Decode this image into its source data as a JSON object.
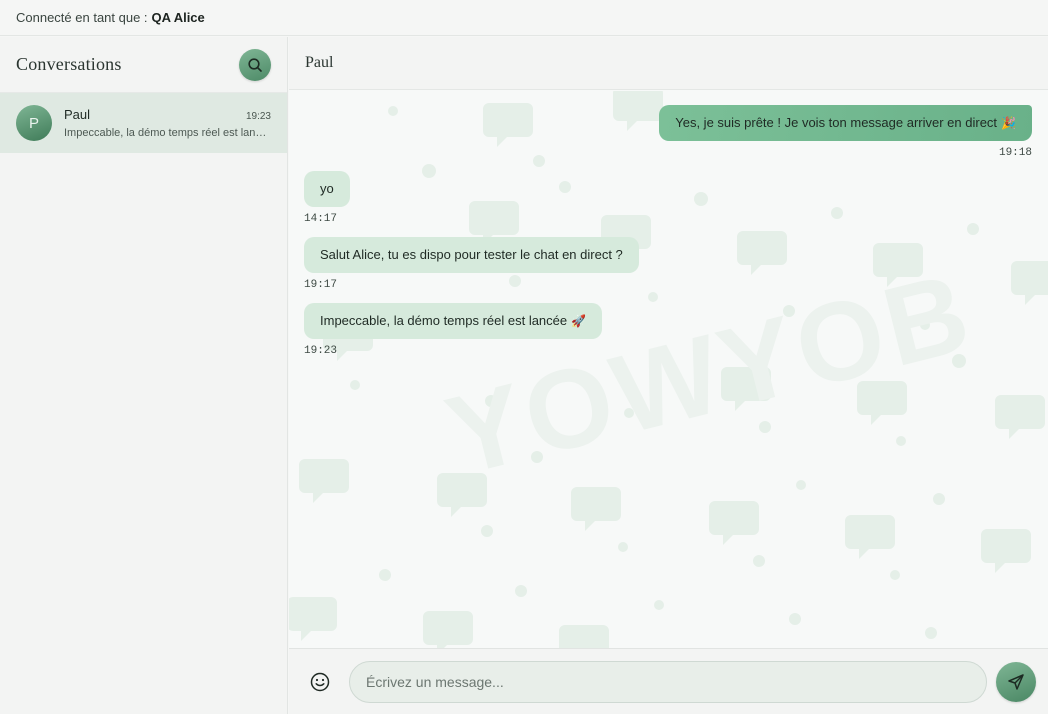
{
  "topbar": {
    "prefix": "Connecté en tant que :",
    "user": "QA Alice"
  },
  "sidebar": {
    "title": "Conversations",
    "search_icon": "search-icon",
    "conversations": [
      {
        "avatar": "P",
        "name": "Paul",
        "time": "19:23",
        "preview": "Impeccable, la démo temps réel est lancée 🚀"
      }
    ]
  },
  "chat": {
    "title": "Paul",
    "watermark": "YOWYOB",
    "messages": [
      {
        "direction": "out",
        "text": "Yes, je suis prête ! Je vois ton message arriver en direct",
        "emoji": "🎉",
        "time": "19:18"
      },
      {
        "direction": "in",
        "text": "yo",
        "emoji": "",
        "time": "14:17"
      },
      {
        "direction": "in",
        "text": "Salut Alice, tu es dispo pour tester le chat en direct ?",
        "emoji": "",
        "time": "19:17"
      },
      {
        "direction": "in",
        "text": "Impeccable, la démo temps réel est lancée",
        "emoji": "🚀",
        "time": "19:23"
      }
    ]
  },
  "composer": {
    "placeholder": "Écrivez un message...",
    "emoji_icon": "smiley-icon",
    "send_icon": "send-icon"
  },
  "colors": {
    "accent": "#5a9a74",
    "outgoing_bubble": "#74b990",
    "incoming_bubble": "#d6eadc",
    "selected_conversation": "#dfe9e2"
  }
}
